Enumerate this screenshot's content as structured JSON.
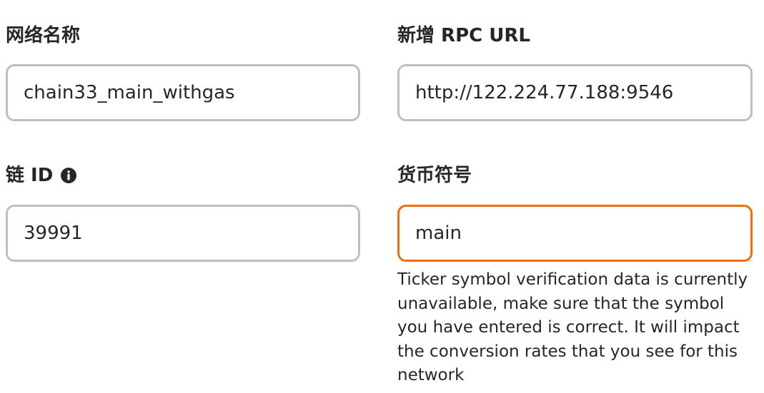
{
  "network_name": {
    "label": "网络名称",
    "value": "chain33_main_withgas"
  },
  "rpc_url": {
    "label": "新增 RPC URL",
    "value": "http://122.224.77.188:9546"
  },
  "chain_id": {
    "label": "链 ID",
    "value": "39991",
    "info_icon": "info-icon"
  },
  "currency_symbol": {
    "label": "货币符号",
    "value": "main",
    "warning": "Ticker symbol verification data is currently unavailable, make sure that the symbol you have entered is correct. It will impact the conversion rates that you see for this network"
  },
  "colors": {
    "border": "#bbc0c5",
    "warning_border": "#f66a0a",
    "text": "#24272a"
  }
}
